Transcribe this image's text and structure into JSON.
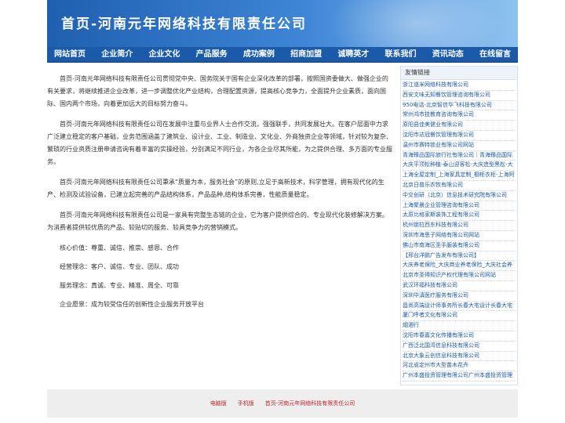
{
  "header": {
    "title": "首页-河南元年网络科技有限责任公司"
  },
  "nav": {
    "items": [
      "网站首页",
      "企业简介",
      "企业文化",
      "产品服务",
      "成功案例",
      "招商加盟",
      "诚聘英才",
      "联系我们",
      "资讯动态",
      "在线留言"
    ]
  },
  "main": {
    "paragraphs": [
      "首页-河南元年网络科技有限责任公司贯彻党中央、国务院关于国有企业深化改革的部署，按照国资委做大、做强企业的有关要求，将继续推进企业改革，进一步调整优化产业结构，合理配置资源，提高核心竞争力，全面提升企业素质，面向国际、国内两个市场，向着更加远大的目标努力奋斗。",
      "首页-河南元年网络科技有限责任公司在发展中注重与业界人士合作交流，强强联手，共同发展壮大。在客户层面中力求广泛建立稳定的客户基础，业务范围涵盖了建筑业、设计业、工业、制造业、文化业、外商独资企业等领域，针对较为复杂、繁琐的行业资质注册申请咨询有着丰富的实操经验，分别满足不同行业，为各企业尽其所能，为之提供合理、多方面的专业服务。",
      "首页-河南元年网络科技有限责任公司秉承“质量为本，服务社会”的原则,立足于高新技术，科学管理，拥有现代化的生产、检测及试验设备，已建立起完善的产品结构体系，产品品种,结构体系完善，性能质量稳定。",
      "首页-河南元年网络科技有限责任公司是一家具有完整生态链的企业，它为客户提供综合的、专业现代化装修解决方案。为消费者提供较优质的产品、较贴切的服务、较具竞争力的营销模式。"
    ],
    "values": [
      "核心价值：尊重、诚信、推崇、感恩、合作",
      "经营理念：客户、诚信、专业、团队、成功",
      "服务理念：真诚、专业、精准、周全、可靠",
      "企业愿景：成为较受信任的创新性企业服务开放平台"
    ]
  },
  "sidebar": {
    "heading": "友情链接",
    "links": [
      "浙江道米网络科技有限公司",
      "西安文味无知餐饮管理咨询有限公司",
      "950电话-北京智信华飞科技有限公司",
      "常州鸿市挂教育咨询有限公司",
      "原阳县佳美健业有限公司",
      "沈阳市达冠餐饮管理有限公司",
      "温州市赛特锁业有限公司网站",
      "青海臻品国际旅行社有限公司｜青海臻品国际",
      "大庆平顶松种植-泰山迎客松-大庆造型黑松-大",
      "上海全屋定制_上海家具定制_橱柜衣柜-上海阿",
      "北京日普乐农牧有限公司",
      "中交创研（北京）信息技术研究院有限公司",
      "上海聚晨企业管理咨询有限公司",
      "太原比格家斯装饰工程有限公司",
      "杭州锁拉西东科技有限公司",
      "深圳市海思子网络有限公司网站",
      "佛山市南海区圣手服装有限公司",
      "【邢台洋鹏广告发布有限公司】",
      "大庆养老保险_大庆商业养老保险_大庆社会养",
      "北京市圣得知识产权代理有限公司网站",
      "武汉环福科技有限公司",
      "深圳华滇医疗服务有限公司",
      "昌尚高端设计师事务所长春大宅设计长春大宅",
      "厦门呼者文化有限公司",
      "烟酒行",
      "沈阳市春嘉文化传播有限公司",
      "广西泛北国湾信息科技有限公司",
      "北京大象云创信息科技有限公司",
      "河北省定州市大型苗木花卉",
      "广州本盛投资管理有限公司广州本盛投资管理"
    ]
  },
  "footer": {
    "links": [
      "电脑版",
      "手机版",
      "首页-河南元年网络科技有限责任公司"
    ]
  }
}
